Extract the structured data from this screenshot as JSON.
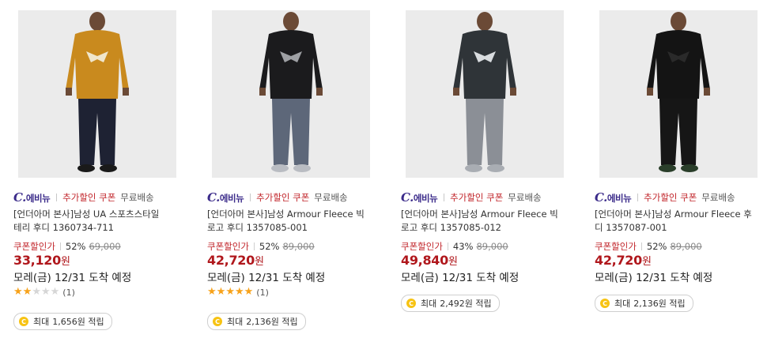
{
  "products": [
    {
      "image_desc": "mustard-hoodie-model",
      "hoodie_color": "#c98a1e",
      "pants_color": "#1e2233",
      "shoe_color": "#1a1a1a",
      "logo_color": "#f0e6cc",
      "brand": {
        "logo_c": "C.",
        "logo_rest": "에비뉴"
      },
      "coupon_label": "추가할인 쿠폰",
      "shipping_label": "무료배송",
      "title_line1": "[언더아머 본사]남성 UA 스포츠스타일",
      "title_line2": "테리 후디 1360734-711",
      "price_label": "쿠폰할인가",
      "discount": "52%",
      "original_price": "69,000",
      "price": "33,120",
      "currency": "원",
      "delivery": "모레(금) 12/31 도착 예정",
      "rating": {
        "value": 2,
        "max": 5,
        "count": "(1)"
      },
      "reward": {
        "label": "최대",
        "amount": "1,656원",
        "suffix": "적립"
      },
      "coin_symbol": "C"
    },
    {
      "image_desc": "black-hoodie-grey-joggers-model",
      "hoodie_color": "#1b1b1d",
      "pants_color": "#5d6779",
      "shoe_color": "#b9bcc2",
      "logo_color": "#9ea0a4",
      "brand": {
        "logo_c": "C.",
        "logo_rest": "에비뉴"
      },
      "coupon_label": "추가할인 쿠폰",
      "shipping_label": "무료배송",
      "title_line1": "[언더아머 본사]남성 Armour Fleece 빅",
      "title_line2": "로고 후디 1357085-001",
      "price_label": "쿠폰할인가",
      "discount": "52%",
      "original_price": "89,000",
      "price": "42,720",
      "currency": "원",
      "delivery": "모레(금) 12/31 도착 예정",
      "rating": {
        "value": 5,
        "max": 5,
        "count": "(1)"
      },
      "reward": {
        "label": "최대",
        "amount": "2,136원",
        "suffix": "적립"
      },
      "coin_symbol": "C"
    },
    {
      "image_desc": "charcoal-hoodie-grey-joggers-model",
      "hoodie_color": "#2f3438",
      "pants_color": "#8b8f96",
      "shoe_color": "#a9adb3",
      "logo_color": "#d9dcdf",
      "brand": {
        "logo_c": "C.",
        "logo_rest": "에비뉴"
      },
      "coupon_label": "추가할인 쿠폰",
      "shipping_label": "무료배송",
      "title_line1": "[언더아머 본사]남성 Armour Fleece 빅",
      "title_line2": "로고 후디 1357085-012",
      "price_label": "쿠폰할인가",
      "discount": "43%",
      "original_price": "89,000",
      "price": "49,840",
      "currency": "원",
      "delivery": "모레(금) 12/31 도착 예정",
      "rating": null,
      "reward": {
        "label": "최대",
        "amount": "2,492원",
        "suffix": "적립"
      },
      "coin_symbol": "C"
    },
    {
      "image_desc": "all-black-hoodie-model",
      "hoodie_color": "#141414",
      "pants_color": "#161616",
      "shoe_color": "#2a3e2a",
      "logo_color": "#2a2a2a",
      "brand": {
        "logo_c": "C.",
        "logo_rest": "에비뉴"
      },
      "coupon_label": "추가할인 쿠폰",
      "shipping_label": "무료배송",
      "title_line1": "[언더아머 본사]남성 Armour Fleece 후",
      "title_line2": "디 1357087-001",
      "price_label": "쿠폰할인가",
      "discount": "52%",
      "original_price": "89,000",
      "price": "42,720",
      "currency": "원",
      "delivery": "모레(금) 12/31 도착 예정",
      "rating": null,
      "reward": {
        "label": "최대",
        "amount": "2,136원",
        "suffix": "적립"
      },
      "coin_symbol": "C"
    }
  ]
}
